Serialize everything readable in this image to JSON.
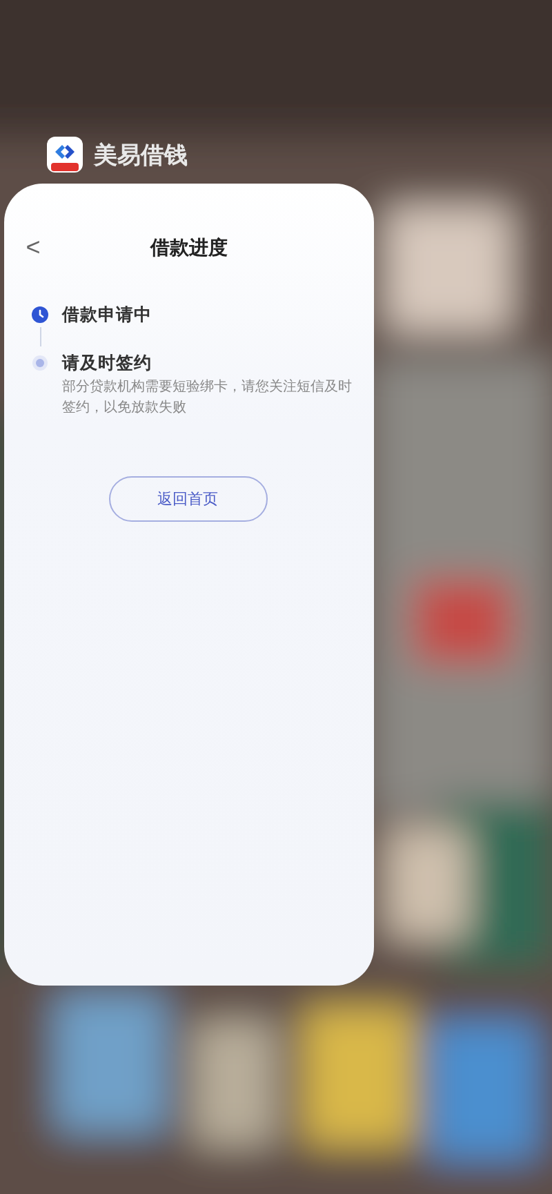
{
  "app": {
    "name": "美易借钱"
  },
  "page": {
    "title": "借款进度",
    "back": "<"
  },
  "steps": [
    {
      "title": "借款申请中",
      "kind": "current"
    },
    {
      "title": "请及时签约",
      "kind": "pending",
      "description": "部分贷款机构需要短验绑卡，请您关注短信及时签约，以免放款失败"
    }
  ],
  "button": {
    "label": "返回首页"
  }
}
